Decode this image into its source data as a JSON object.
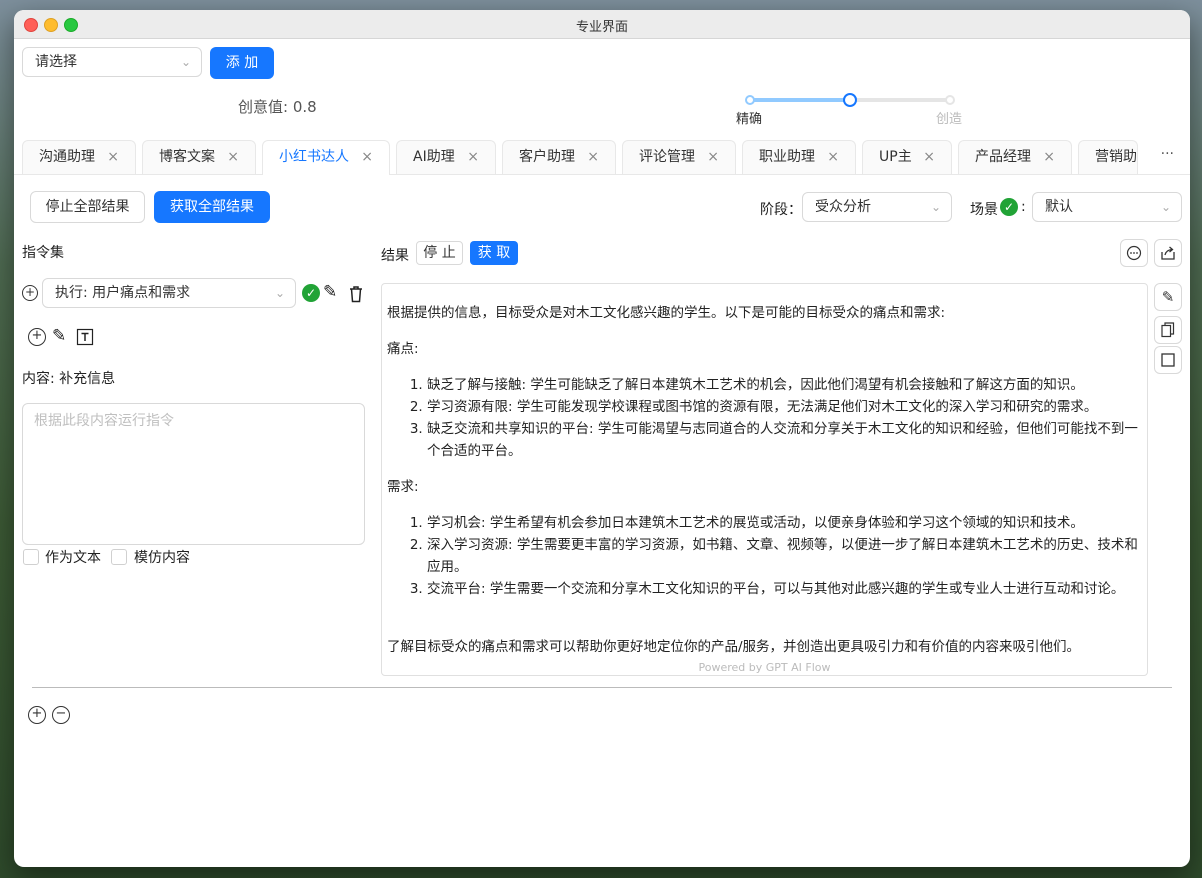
{
  "window": {
    "title": "专业界面"
  },
  "top": {
    "select_placeholder": "请选择",
    "add_label": "添 加",
    "creativity_text": "创意值: 0.8",
    "slider_left_label": "精确",
    "slider_right_label": "创造",
    "slider_value": 0.8
  },
  "tabs": [
    {
      "label": "沟通助理"
    },
    {
      "label": "博客文案"
    },
    {
      "label": "小红书达人"
    },
    {
      "label": "AI助理"
    },
    {
      "label": "客户助理"
    },
    {
      "label": "评论管理"
    },
    {
      "label": "职业助理"
    },
    {
      "label": "UP主"
    },
    {
      "label": "产品经理"
    },
    {
      "label": "营销助"
    }
  ],
  "tab_close_icon": "×",
  "tabs_more": "···",
  "toolbar": {
    "stop_all_label": "停止全部结果",
    "get_all_label": "获取全部结果",
    "stage_label": "阶段：",
    "stage_value": "受众分析",
    "scene_label": "场景",
    "scene_colon": ":",
    "scene_value": "默认"
  },
  "left": {
    "instruction_set_label": "指令集",
    "execute_value": "执行: 用户痛点和需求",
    "content_label": "内容: 补充信息",
    "textarea_placeholder": "根据此段内容运行指令",
    "as_text_label": "作为文本",
    "imitate_label": "模仿内容"
  },
  "result": {
    "label": "结果",
    "stop_label": "停 止",
    "get_label": "获 取",
    "intro": "根据提供的信息，目标受众是对木工文化感兴趣的学生。以下是可能的目标受众的痛点和需求:",
    "pain_heading": "痛点:",
    "pain_items": [
      "缺乏了解与接触: 学生可能缺乏了解日本建筑木工艺术的机会，因此他们渴望有机会接触和了解这方面的知识。",
      "学习资源有限: 学生可能发现学校课程或图书馆的资源有限，无法满足他们对木工文化的深入学习和研究的需求。",
      "缺乏交流和共享知识的平台: 学生可能渴望与志同道合的人交流和分享关于木工文化的知识和经验，但他们可能找不到一个合适的平台。"
    ],
    "needs_heading": "需求:",
    "needs_items": [
      "学习机会: 学生希望有机会参加日本建筑木工艺术的展览或活动，以便亲身体验和学习这个领域的知识和技术。",
      "深入学习资源: 学生需要更丰富的学习资源，如书籍、文章、视频等，以便进一步了解日本建筑木工艺术的历史、技术和应用。",
      "交流平台: 学生需要一个交流和分享木工文化知识的平台，可以与其他对此感兴趣的学生或专业人士进行互动和讨论。"
    ],
    "conclusion": "了解目标受众的痛点和需求可以帮助你更好地定位你的产品/服务，并创造出更具吸引力和有价值的内容来吸引他们。",
    "powered_by": "Powered by GPT AI Flow"
  },
  "colors": {
    "primary": "#1677ff",
    "success": "#21a336",
    "slider_track": "#91caff"
  }
}
